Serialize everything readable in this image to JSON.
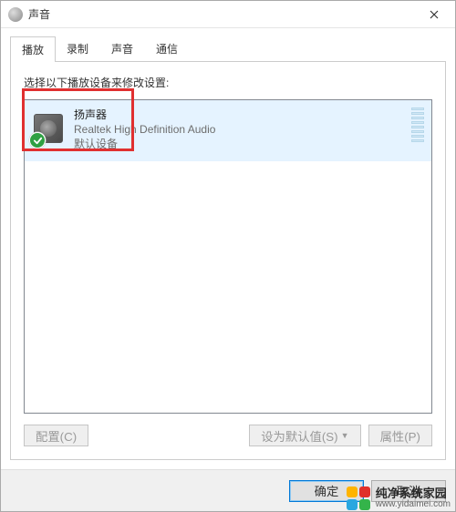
{
  "window": {
    "title": "声音"
  },
  "tabs": [
    {
      "label": "播放",
      "active": true
    },
    {
      "label": "录制",
      "active": false
    },
    {
      "label": "声音",
      "active": false
    },
    {
      "label": "通信",
      "active": false
    }
  ],
  "instruction": "选择以下播放设备来修改设置:",
  "devices": [
    {
      "name": "扬声器",
      "driver": "Realtek High Definition Audio",
      "status": "默认设备",
      "selected": true,
      "default": true
    }
  ],
  "panel_buttons": {
    "configure": "配置(C)",
    "set_default": "设为默认值(S)",
    "properties": "属性(P)"
  },
  "footer": {
    "ok": "确定",
    "cancel": "取消"
  },
  "watermark": {
    "line1": "纯净系统家园",
    "line2": "www.yidaimei.com"
  }
}
